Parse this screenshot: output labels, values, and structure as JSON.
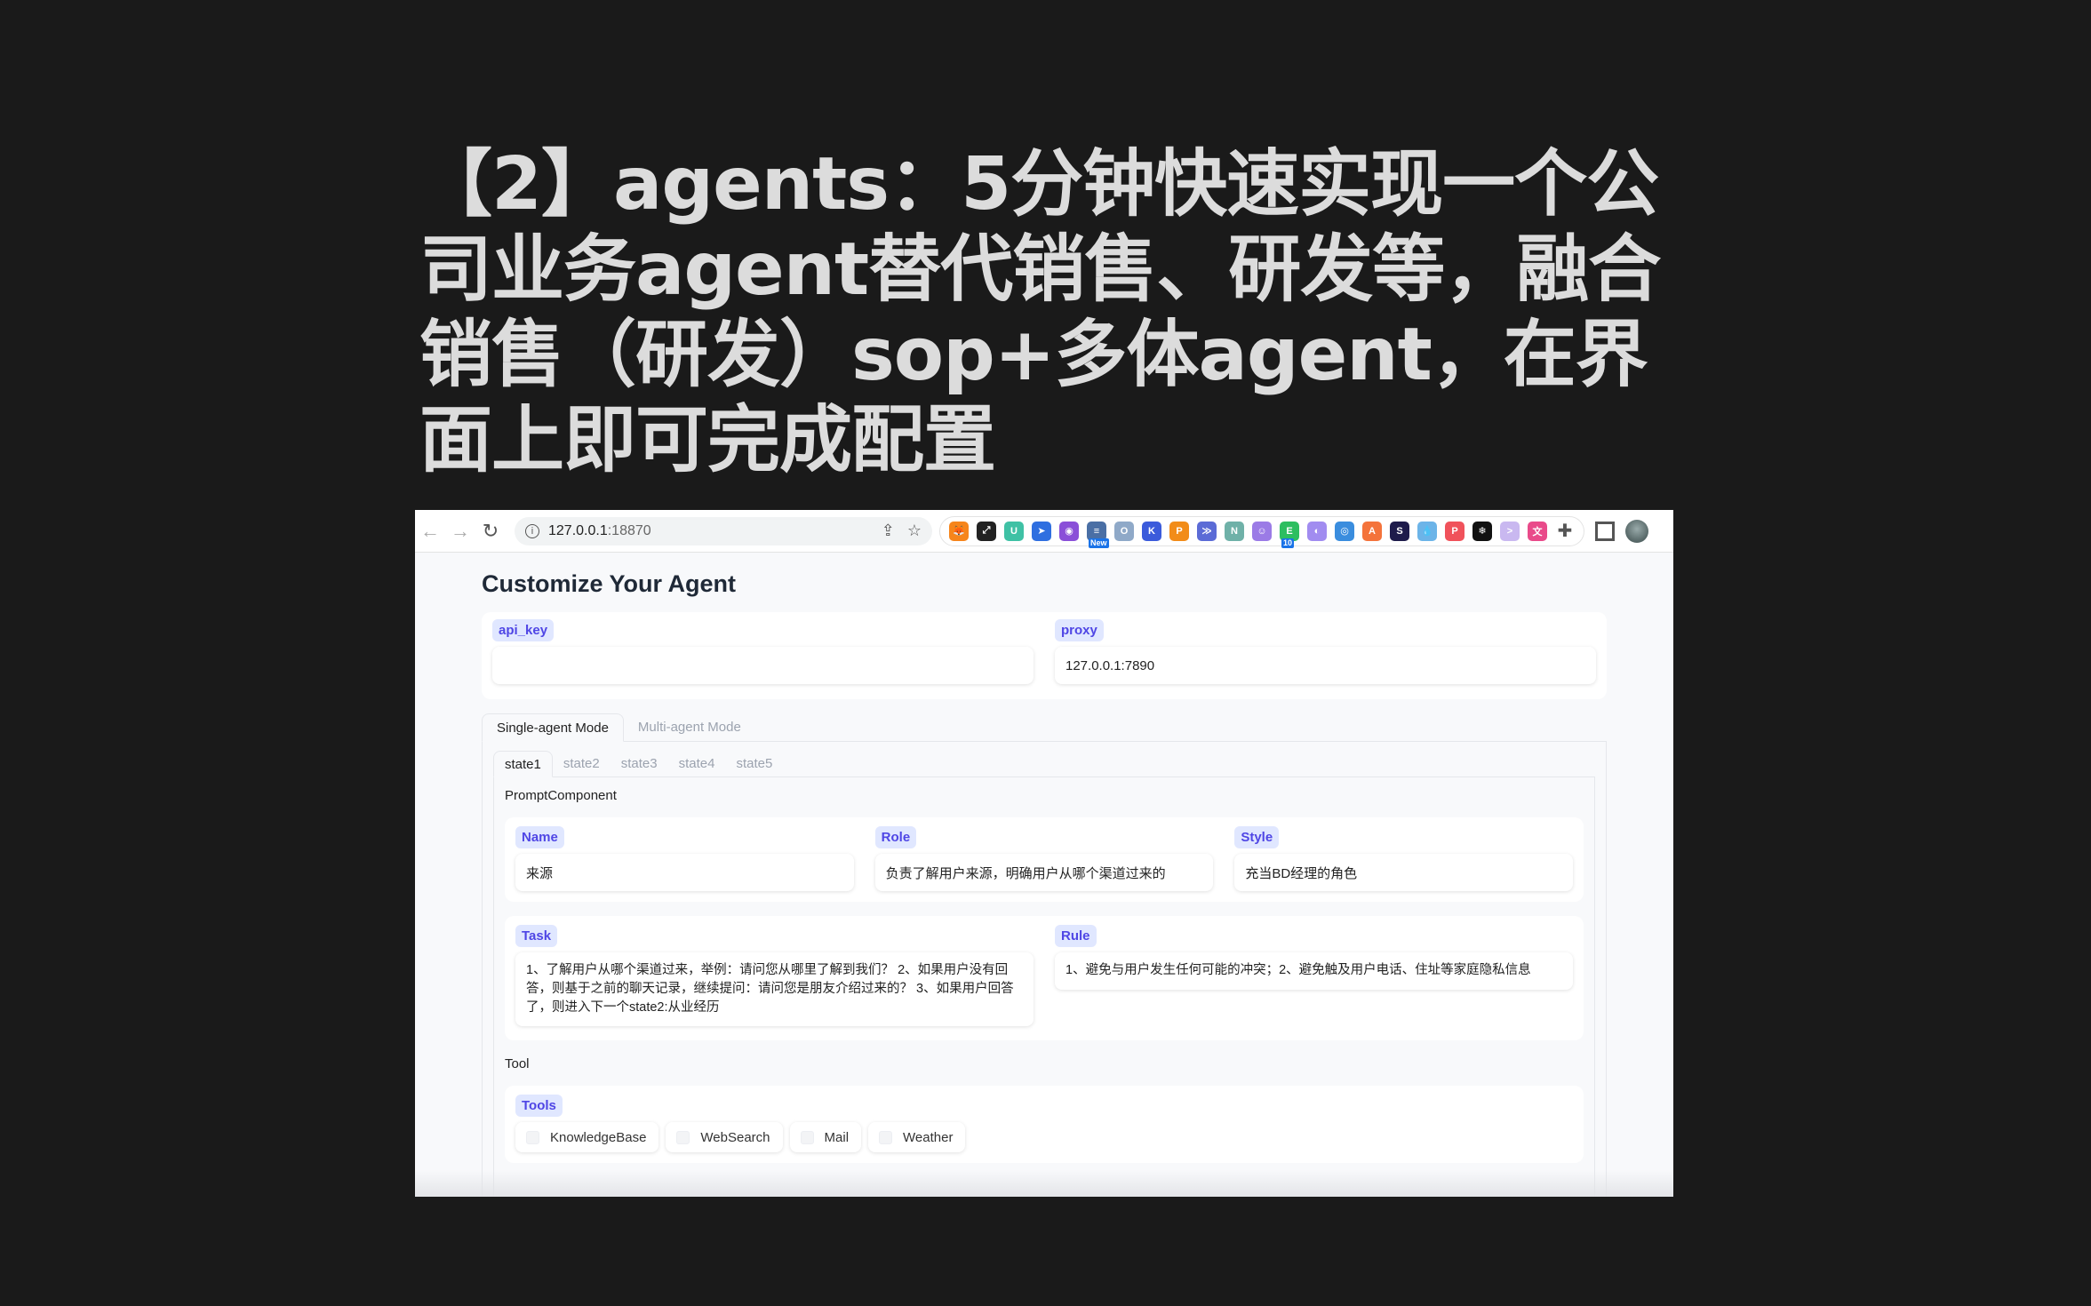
{
  "headline": "【2】agents：5分钟快速实现一个公司业务agent替代销售、研发等，融合销售（研发）sop+多体agent，在界面上即可完成配置",
  "browser": {
    "url_host": "127.0.0.1",
    "url_port": ":18870",
    "extensions": [
      {
        "name": "metamask",
        "color": "#f6851b",
        "glyph": "🦊"
      },
      {
        "name": "ext-dark-1",
        "color": "#222222",
        "glyph": "⤢"
      },
      {
        "name": "uno",
        "color": "#3fc1a5",
        "glyph": "Uno"
      },
      {
        "name": "ext-blue-send",
        "color": "#2f6fe0",
        "glyph": "➤"
      },
      {
        "name": "ext-rainbow",
        "color": "#8a4fd8",
        "glyph": "◉"
      },
      {
        "name": "ext-new",
        "color": "#4a6fa5",
        "glyph": "≡",
        "badge": "New"
      },
      {
        "name": "ext-ring",
        "color": "#8fa9c8",
        "glyph": "O"
      },
      {
        "name": "kimi",
        "color": "#3b5bdb",
        "glyph": "K"
      },
      {
        "name": "ext-orange-p",
        "color": "#f28c18",
        "glyph": "P"
      },
      {
        "name": "ext-chevrons",
        "color": "#5b6bd6",
        "glyph": "≫"
      },
      {
        "name": "ext-n",
        "color": "#6fb1a8",
        "glyph": "N"
      },
      {
        "name": "ext-purple-face",
        "color": "#9b7be6",
        "glyph": "☺"
      },
      {
        "name": "evernote",
        "color": "#2dbe60",
        "glyph": "E",
        "badge": "10"
      },
      {
        "name": "ext-ghost",
        "color": "#a18cf0",
        "glyph": "◐"
      },
      {
        "name": "ext-blue-ring",
        "color": "#3a8dde",
        "glyph": "◎"
      },
      {
        "name": "ext-orange-a",
        "color": "#f4733b",
        "glyph": "A"
      },
      {
        "name": "ext-dark-s",
        "color": "#1e1b4b",
        "glyph": "S"
      },
      {
        "name": "ext-drop",
        "color": "#6cb4e8",
        "glyph": "💧"
      },
      {
        "name": "ext-red-p",
        "color": "#f0525b",
        "glyph": "P"
      },
      {
        "name": "ext-snowflake",
        "color": "#111111",
        "glyph": "❄"
      },
      {
        "name": "ext-face",
        "color": "#c9b8f0",
        "glyph": ">.<"
      },
      {
        "name": "translate",
        "color": "#e94a8a",
        "glyph": "文"
      }
    ]
  },
  "page": {
    "title": "Customize Your Agent",
    "api_key": {
      "label": "api_key",
      "value": ""
    },
    "proxy": {
      "label": "proxy",
      "value": "127.0.0.1:7890"
    },
    "mode_tabs": [
      {
        "label": "Single-agent Mode",
        "active": true
      },
      {
        "label": "Multi-agent Mode",
        "active": false
      }
    ],
    "state_tabs": [
      {
        "label": "state1",
        "active": true
      },
      {
        "label": "state2",
        "active": false
      },
      {
        "label": "state3",
        "active": false
      },
      {
        "label": "state4",
        "active": false
      },
      {
        "label": "state5",
        "active": false
      }
    ],
    "prompt_component": {
      "section_label": "PromptComponent",
      "name": {
        "label": "Name",
        "value": "来源"
      },
      "role": {
        "label": "Role",
        "value": "负责了解用户来源，明确用户从哪个渠道过来的"
      },
      "style": {
        "label": "Style",
        "value": "充当BD经理的角色"
      },
      "task": {
        "label": "Task",
        "value": "1、了解用户从哪个渠道过来，举例：请问您从哪里了解到我们？ 2、如果用户没有回答，则基于之前的聊天记录，继续提问：请问您是朋友介绍过来的？ 3、如果用户回答了，则进入下一个state2:从业经历"
      },
      "rule": {
        "label": "Rule",
        "value": "1、避免与用户发生任何可能的冲突；2、避免触及用户电话、住址等家庭隐私信息"
      }
    },
    "tool": {
      "section_label": "Tool",
      "tools_label": "Tools",
      "options": [
        {
          "label": "KnowledgeBase",
          "checked": false
        },
        {
          "label": "WebSearch",
          "checked": false
        },
        {
          "label": "Mail",
          "checked": false
        },
        {
          "label": "Weather",
          "checked": false
        }
      ]
    }
  }
}
